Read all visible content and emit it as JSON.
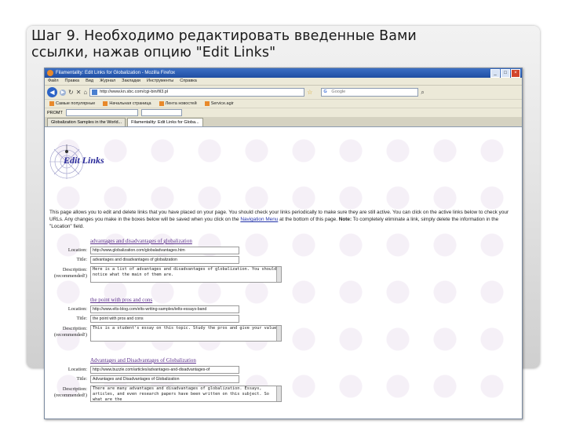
{
  "slide": {
    "title": "Шаг 9. Необходимо редактировать введенные Вами\nссылки, нажав опцию \"Edit Links\""
  },
  "browser": {
    "window_title": "Filamentality: Edit Links for Globalization - Mozilla Firefox",
    "menu": [
      "Файл",
      "Правка",
      "Вид",
      "Журнал",
      "Закладки",
      "Инструменты",
      "Справка"
    ],
    "url": "http://www.kn.sbc.com/cgi-bin/fil3.pl",
    "search_placeholder": "Google",
    "bookmarks": [
      "Самые популярные",
      "Начальная страница",
      "Лента новостей",
      "Service.agir"
    ],
    "promt_label": "PROMT",
    "promt_value": "",
    "tabs": [
      {
        "label": "Globalization Samples in the World...",
        "active": false
      },
      {
        "label": "Filamentality: Edit Links for Globa...",
        "active": true
      }
    ]
  },
  "page": {
    "logo_text": "Edit Links",
    "intro_part1": "This page allows you to edit and delete links that you have placed on your page. You should check your links periodically to make sure they are still active. You can click on the active links below to check your URLs. Any changes you make in the boxes below will be saved when you click on the ",
    "intro_link": "Navigation Menu",
    "intro_part2": " at the bottom of this page. ",
    "intro_note_label": "Note:",
    "intro_part3": " To completely eliminate a link, simply delete the information in the \"Location\" field.",
    "labels": {
      "location": "Location:",
      "title": "Title:",
      "description": "Description:",
      "recommended": "(recommended!)"
    },
    "entries": [
      {
        "heading": "advantages and disadvantages of globalization",
        "location": "http://www.globalization.com/globaladvantages.htm",
        "title": "advantages and disadvantages of globalization",
        "description": "Here is a list of advantages and disadvantages of globalization. You should notice what the main of them are."
      },
      {
        "heading": "the point with pros and cons",
        "location": "http://www.elts-blog.com/elts-writing-samples/ielts-essays-band",
        "title": "the point with pros and cons",
        "description": "This is a student's essay on this topic. Study the pros and give your value."
      },
      {
        "heading": "Advantages and Disadvantages of Globalization",
        "location": "http://www.buzzle.com/articles/advantages-and-disadvantages-of",
        "title": "Advantages and Disadvantages of Globalization",
        "description": "There are many advantages and disadvantages of globalization. Essays, articles, and even research papers have been written on this subject. So what are the"
      }
    ]
  }
}
